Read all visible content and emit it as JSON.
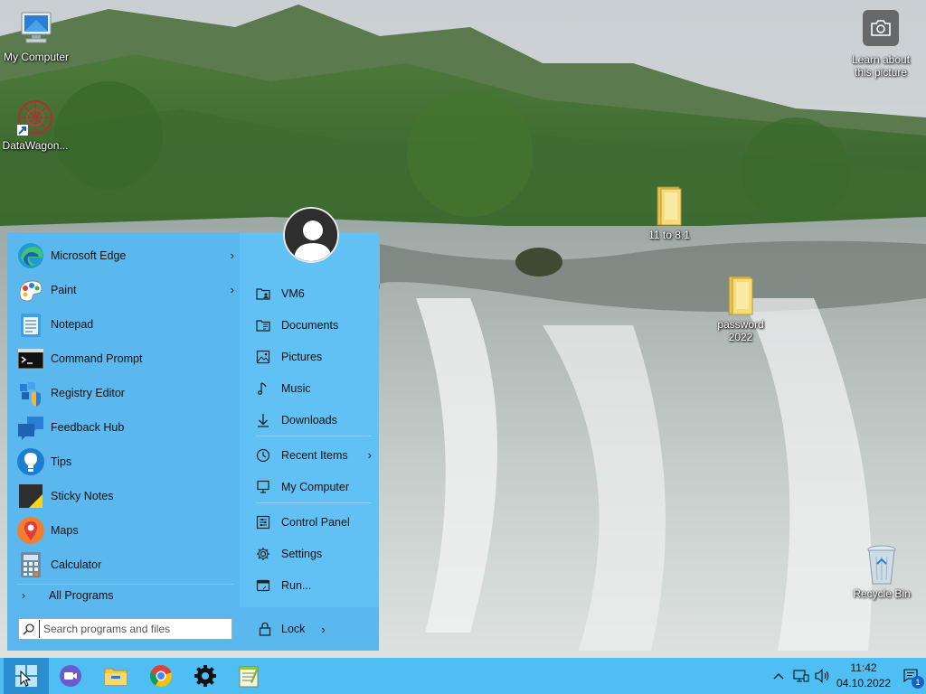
{
  "desktop": {
    "icons": [
      {
        "label": "My Computer"
      },
      {
        "label": "DataWagon..."
      },
      {
        "label": "11 to 8.1"
      },
      {
        "label": "password 2022"
      },
      {
        "label": "Recycle Bin"
      }
    ],
    "learn_picture": "Learn about this picture"
  },
  "start_menu": {
    "programs": [
      {
        "label": "Microsoft Edge",
        "icon": "edge-icon",
        "submenu": true
      },
      {
        "label": "Paint",
        "icon": "paint-icon",
        "submenu": true
      },
      {
        "label": "Notepad",
        "icon": "notepad-icon"
      },
      {
        "label": "Command Prompt",
        "icon": "cmd-icon"
      },
      {
        "label": "Registry Editor",
        "icon": "regedit-icon"
      },
      {
        "label": "Feedback Hub",
        "icon": "feedback-icon"
      },
      {
        "label": "Tips",
        "icon": "tips-icon"
      },
      {
        "label": "Sticky Notes",
        "icon": "sticky-notes-icon"
      },
      {
        "label": "Maps",
        "icon": "maps-icon"
      },
      {
        "label": "Calculator",
        "icon": "calculator-icon"
      }
    ],
    "all_programs": "All Programs",
    "search_placeholder": "Search programs and files",
    "links": [
      {
        "label": "VM6",
        "icon": "user-folder-icon"
      },
      {
        "label": "Documents",
        "icon": "documents-icon"
      },
      {
        "label": "Pictures",
        "icon": "pictures-icon"
      },
      {
        "label": "Music",
        "icon": "music-icon"
      },
      {
        "label": "Downloads",
        "icon": "downloads-icon"
      },
      {
        "label": "Recent Items",
        "icon": "recent-icon",
        "submenu": true
      },
      {
        "label": "My Computer",
        "icon": "computer-icon"
      },
      {
        "label": "Control Panel",
        "icon": "control-panel-icon"
      },
      {
        "label": "Settings",
        "icon": "settings-icon"
      },
      {
        "label": "Run...",
        "icon": "run-icon"
      }
    ],
    "lock": "Lock"
  },
  "taskbar": {
    "time": "11:42",
    "date": "04.10.2022",
    "notification_count": "1"
  },
  "colors": {
    "menu_left": "#5ab8ee",
    "menu_right": "#61c0f4",
    "taskbar": "#4fbff3"
  }
}
